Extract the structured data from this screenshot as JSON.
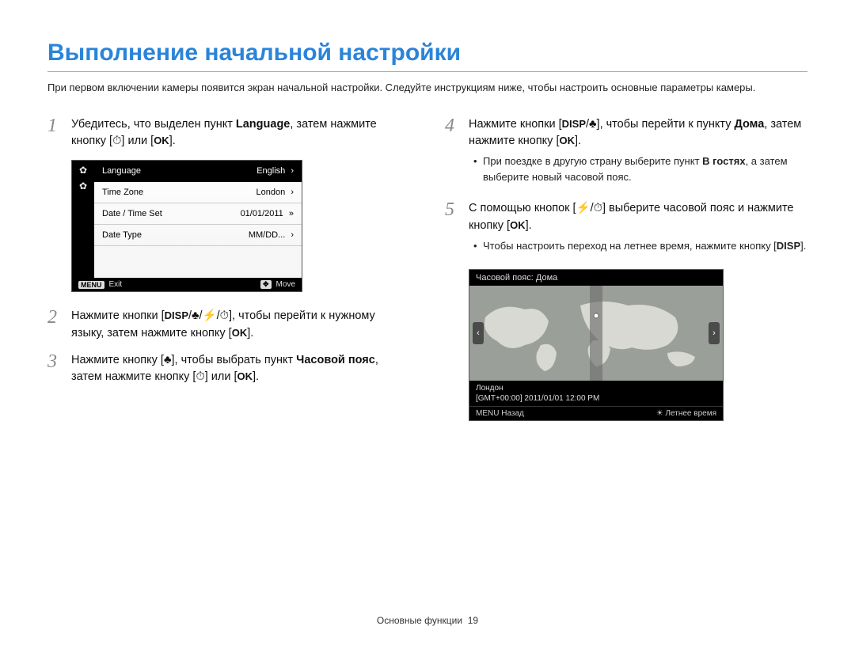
{
  "title": "Выполнение начальной настройки",
  "intro": "При первом включении камеры появится экран начальной настройки. Следуйте инструкциям ниже, чтобы настроить основные параметры камеры.",
  "icons": {
    "disp": "DISP",
    "ok": "OK",
    "menu": "MENU",
    "macro": "♣",
    "flash": "⚡",
    "timer": "⏱",
    "nav": "✥"
  },
  "steps": {
    "s1a": "Убедитесь, что выделен пункт ",
    "s1b": "Language",
    "s1c": ", затем нажмите кнопку [",
    "s1d": "] или [",
    "s1e": "].",
    "s2a": "Нажмите кнопки [",
    "s2b": "], чтобы перейти к нужному языку, затем нажмите кнопку [",
    "s2c": "].",
    "s3a": "Нажмите кнопку [",
    "s3b": "], чтобы выбрать пункт ",
    "s3c": "Часовой пояс",
    "s3d": ", затем нажмите кнопку [",
    "s3e": "] или [",
    "s3f": "].",
    "s4a": "Нажмите кнопки [",
    "s4b": "], чтобы перейти к пункту ",
    "s4c": "Дома",
    "s4d": ", затем нажмите кнопку [",
    "s4e": "].",
    "s4bullet_a": "При поездке в другую страну выберите пункт ",
    "s4bullet_b": "В гостях",
    "s4bullet_c": ", а затем выберите новый часовой пояс.",
    "s5a": "С помощью кнопок [",
    "s5b": "] выберите часовой пояс и нажмите кнопку [",
    "s5c": "].",
    "s5bullet_a": "Чтобы настроить переход на летнее время, нажмите кнопку [",
    "s5bullet_b": "]."
  },
  "menu": {
    "rows": [
      {
        "label": "Language",
        "value": "English",
        "selected": true
      },
      {
        "label": "Time Zone",
        "value": "London",
        "selected": false
      },
      {
        "label": "Date / Time Set",
        "value": "01/01/2011",
        "selected": false
      },
      {
        "label": "Date Type",
        "value": "MM/DD...",
        "selected": false
      }
    ],
    "footer_left": "Exit",
    "footer_right": "Move"
  },
  "tz": {
    "title": "Часовой пояс: Дома",
    "city": "Лондон",
    "gmt": "[GMT+00:00] 2011/01/01 12:00 PM",
    "footer_left": "Назад",
    "footer_right": "Летнее время"
  },
  "footer": {
    "section": "Основные функции",
    "page": "19"
  }
}
